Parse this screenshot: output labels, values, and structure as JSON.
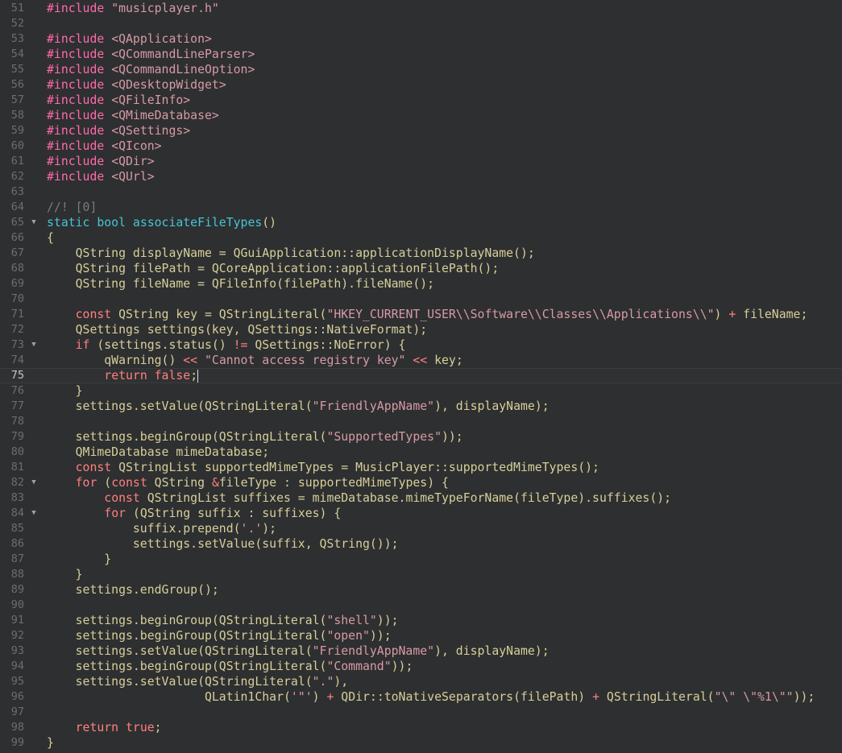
{
  "editor": {
    "colors": {
      "background": "#2e2f30",
      "default": "#d6cf9a",
      "preprocessor": "#ff6aad",
      "keyword": "#45c6d6",
      "string": "#d69aa7",
      "comment": "#7a7c7d",
      "gutter": "#6b6e70"
    },
    "current_line": 75,
    "lines": [
      {
        "num": "51",
        "fold": false,
        "tokens": [
          [
            "pre",
            "#include "
          ],
          [
            "str",
            "\"musicplayer.h\""
          ]
        ]
      },
      {
        "num": "52",
        "fold": false,
        "tokens": []
      },
      {
        "num": "53",
        "fold": false,
        "tokens": [
          [
            "pre",
            "#include "
          ],
          [
            "str",
            "<QApplication>"
          ]
        ]
      },
      {
        "num": "54",
        "fold": false,
        "tokens": [
          [
            "pre",
            "#include "
          ],
          [
            "str",
            "<QCommandLineParser>"
          ]
        ]
      },
      {
        "num": "55",
        "fold": false,
        "tokens": [
          [
            "pre",
            "#include "
          ],
          [
            "str",
            "<QCommandLineOption>"
          ]
        ]
      },
      {
        "num": "56",
        "fold": false,
        "tokens": [
          [
            "pre",
            "#include "
          ],
          [
            "str",
            "<QDesktopWidget>"
          ]
        ]
      },
      {
        "num": "57",
        "fold": false,
        "tokens": [
          [
            "pre",
            "#include "
          ],
          [
            "str",
            "<QFileInfo>"
          ]
        ]
      },
      {
        "num": "58",
        "fold": false,
        "tokens": [
          [
            "pre",
            "#include "
          ],
          [
            "str",
            "<QMimeDatabase>"
          ]
        ]
      },
      {
        "num": "59",
        "fold": false,
        "tokens": [
          [
            "pre",
            "#include "
          ],
          [
            "str",
            "<QSettings>"
          ]
        ]
      },
      {
        "num": "60",
        "fold": false,
        "tokens": [
          [
            "pre",
            "#include "
          ],
          [
            "str",
            "<QIcon>"
          ]
        ]
      },
      {
        "num": "61",
        "fold": false,
        "tokens": [
          [
            "pre",
            "#include "
          ],
          [
            "str",
            "<QDir>"
          ]
        ]
      },
      {
        "num": "62",
        "fold": false,
        "tokens": [
          [
            "pre",
            "#include "
          ],
          [
            "str",
            "<QUrl>"
          ]
        ]
      },
      {
        "num": "63",
        "fold": false,
        "tokens": []
      },
      {
        "num": "64",
        "fold": false,
        "tokens": [
          [
            "cmt",
            "//! [0]"
          ]
        ]
      },
      {
        "num": "65",
        "fold": true,
        "tokens": [
          [
            "kw",
            "static "
          ],
          [
            "kw",
            "bool "
          ],
          [
            "fn",
            "associateFileTypes"
          ],
          [
            "sym",
            "()"
          ]
        ]
      },
      {
        "num": "66",
        "fold": false,
        "tokens": [
          [
            "sym",
            "{"
          ]
        ]
      },
      {
        "num": "67",
        "fold": false,
        "tokens": [
          [
            "sym",
            "    QString displayName = QGuiApplication::applicationDisplayName();"
          ]
        ]
      },
      {
        "num": "68",
        "fold": false,
        "tokens": [
          [
            "sym",
            "    QString filePath = QCoreApplication::applicationFilePath();"
          ]
        ]
      },
      {
        "num": "69",
        "fold": false,
        "tokens": [
          [
            "sym",
            "    QString fileName = QFileInfo(filePath).fileName();"
          ]
        ]
      },
      {
        "num": "70",
        "fold": false,
        "tokens": []
      },
      {
        "num": "71",
        "fold": false,
        "tokens": [
          [
            "sym",
            "    "
          ],
          [
            "ret",
            "const "
          ],
          [
            "sym",
            "QString key = QStringLiteral("
          ],
          [
            "str",
            "\"HKEY_CURRENT_USER\\\\Software\\\\Classes\\\\Applications\\\\\""
          ],
          [
            "sym",
            ") "
          ],
          [
            "ret",
            "+"
          ],
          [
            "sym",
            " fileName;"
          ]
        ]
      },
      {
        "num": "72",
        "fold": false,
        "tokens": [
          [
            "sym",
            "    QSettings settings(key, QSettings::NativeFormat);"
          ]
        ]
      },
      {
        "num": "73",
        "fold": true,
        "tokens": [
          [
            "sym",
            "    "
          ],
          [
            "ret",
            "if "
          ],
          [
            "sym",
            "(settings.status() "
          ],
          [
            "ret",
            "!="
          ],
          [
            "sym",
            " QSettings::NoError) {"
          ]
        ]
      },
      {
        "num": "74",
        "fold": false,
        "tokens": [
          [
            "sym",
            "        qWarning() "
          ],
          [
            "ret",
            "<<"
          ],
          [
            "sym",
            " "
          ],
          [
            "str",
            "\"Cannot access registry key\""
          ],
          [
            "sym",
            " "
          ],
          [
            "ret",
            "<<"
          ],
          [
            "sym",
            " key;"
          ]
        ]
      },
      {
        "num": "75",
        "fold": false,
        "tokens": [
          [
            "sym",
            "        "
          ],
          [
            "ret",
            "return false"
          ],
          [
            "sym",
            ";"
          ]
        ]
      },
      {
        "num": "76",
        "fold": false,
        "tokens": [
          [
            "sym",
            "    }"
          ]
        ]
      },
      {
        "num": "77",
        "fold": false,
        "tokens": [
          [
            "sym",
            "    settings.setValue(QStringLiteral("
          ],
          [
            "str",
            "\"FriendlyAppName\""
          ],
          [
            "sym",
            "), displayName);"
          ]
        ]
      },
      {
        "num": "78",
        "fold": false,
        "tokens": []
      },
      {
        "num": "79",
        "fold": false,
        "tokens": [
          [
            "sym",
            "    settings.beginGroup(QStringLiteral("
          ],
          [
            "str",
            "\"SupportedTypes\""
          ],
          [
            "sym",
            "));"
          ]
        ]
      },
      {
        "num": "80",
        "fold": false,
        "tokens": [
          [
            "sym",
            "    QMimeDatabase mimeDatabase;"
          ]
        ]
      },
      {
        "num": "81",
        "fold": false,
        "tokens": [
          [
            "sym",
            "    "
          ],
          [
            "ret",
            "const "
          ],
          [
            "sym",
            "QStringList supportedMimeTypes = MusicPlayer::supportedMimeTypes();"
          ]
        ]
      },
      {
        "num": "82",
        "fold": true,
        "tokens": [
          [
            "sym",
            "    "
          ],
          [
            "ret",
            "for "
          ],
          [
            "sym",
            "("
          ],
          [
            "ret",
            "const "
          ],
          [
            "sym",
            "QString "
          ],
          [
            "ret",
            "&"
          ],
          [
            "sym",
            "fileType : supportedMimeTypes) {"
          ]
        ]
      },
      {
        "num": "83",
        "fold": false,
        "tokens": [
          [
            "sym",
            "        "
          ],
          [
            "ret",
            "const "
          ],
          [
            "sym",
            "QStringList suffixes = mimeDatabase.mimeTypeForName(fileType).suffixes();"
          ]
        ]
      },
      {
        "num": "84",
        "fold": true,
        "tokens": [
          [
            "sym",
            "        "
          ],
          [
            "ret",
            "for "
          ],
          [
            "sym",
            "(QString suffix : suffixes) {"
          ]
        ]
      },
      {
        "num": "85",
        "fold": false,
        "tokens": [
          [
            "sym",
            "            suffix.prepend("
          ],
          [
            "str",
            "'.'"
          ],
          [
            "sym",
            ");"
          ]
        ]
      },
      {
        "num": "86",
        "fold": false,
        "tokens": [
          [
            "sym",
            "            settings.setValue(suffix, QString());"
          ]
        ]
      },
      {
        "num": "87",
        "fold": false,
        "tokens": [
          [
            "sym",
            "        }"
          ]
        ]
      },
      {
        "num": "88",
        "fold": false,
        "tokens": [
          [
            "sym",
            "    }"
          ]
        ]
      },
      {
        "num": "89",
        "fold": false,
        "tokens": [
          [
            "sym",
            "    settings.endGroup();"
          ]
        ]
      },
      {
        "num": "90",
        "fold": false,
        "tokens": []
      },
      {
        "num": "91",
        "fold": false,
        "tokens": [
          [
            "sym",
            "    settings.beginGroup(QStringLiteral("
          ],
          [
            "str",
            "\"shell\""
          ],
          [
            "sym",
            "));"
          ]
        ]
      },
      {
        "num": "92",
        "fold": false,
        "tokens": [
          [
            "sym",
            "    settings.beginGroup(QStringLiteral("
          ],
          [
            "str",
            "\"open\""
          ],
          [
            "sym",
            "));"
          ]
        ]
      },
      {
        "num": "93",
        "fold": false,
        "tokens": [
          [
            "sym",
            "    settings.setValue(QStringLiteral("
          ],
          [
            "str",
            "\"FriendlyAppName\""
          ],
          [
            "sym",
            "), displayName);"
          ]
        ]
      },
      {
        "num": "94",
        "fold": false,
        "tokens": [
          [
            "sym",
            "    settings.beginGroup(QStringLiteral("
          ],
          [
            "str",
            "\"Command\""
          ],
          [
            "sym",
            "));"
          ]
        ]
      },
      {
        "num": "95",
        "fold": false,
        "tokens": [
          [
            "sym",
            "    settings.setValue(QStringLiteral("
          ],
          [
            "str",
            "\".\""
          ],
          [
            "sym",
            "),"
          ]
        ]
      },
      {
        "num": "96",
        "fold": false,
        "tokens": [
          [
            "sym",
            "                      QLatin1Char("
          ],
          [
            "str",
            "'\"'"
          ],
          [
            "sym",
            ") "
          ],
          [
            "ret",
            "+"
          ],
          [
            "sym",
            " QDir::toNativeSeparators(filePath) "
          ],
          [
            "ret",
            "+"
          ],
          [
            "sym",
            " QStringLiteral("
          ],
          [
            "str",
            "\"\\\" \\\"%1\\\"\""
          ],
          [
            "sym",
            "));"
          ]
        ]
      },
      {
        "num": "97",
        "fold": false,
        "tokens": []
      },
      {
        "num": "98",
        "fold": false,
        "tokens": [
          [
            "sym",
            "    "
          ],
          [
            "ret",
            "return true"
          ],
          [
            "sym",
            ";"
          ]
        ]
      },
      {
        "num": "99",
        "fold": false,
        "tokens": [
          [
            "sym",
            "}"
          ]
        ]
      }
    ]
  }
}
